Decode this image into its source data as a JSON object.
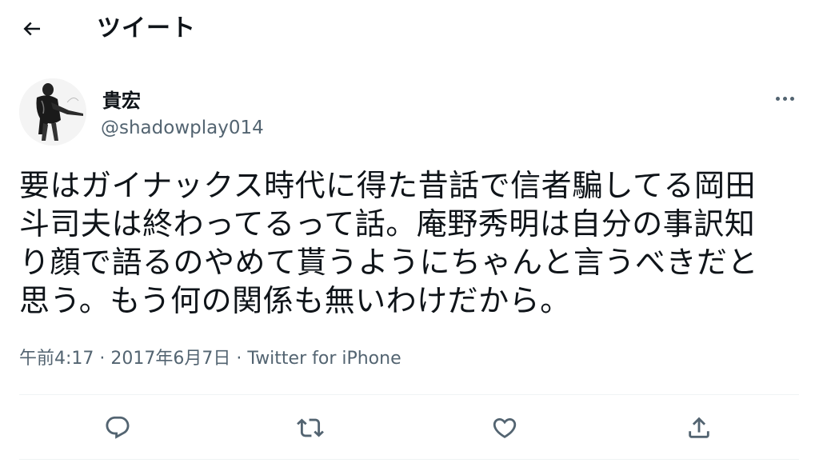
{
  "header": {
    "back_icon": "arrow-left-icon",
    "title": "ツイート"
  },
  "author": {
    "display_name": "貴宏",
    "handle": "@shadowplay014",
    "avatar_icon": "avatar-illustration"
  },
  "tweet": {
    "lines": [
      "要はガイナックス時代に得た昔話で信者騙してる岡田",
      "斗司夫は終わってるって話。庵野秀明は自分の事訳知",
      "り顔で語るのやめて貰うようにちゃんと言うべきだと",
      "思う。もう何の関係も無いわけだから。"
    ]
  },
  "meta": {
    "time": "午前4:17",
    "separator": "·",
    "date": "2017年6月7日",
    "source": "Twitter for iPhone"
  },
  "actions": {
    "reply_icon": "reply-icon",
    "retweet_icon": "retweet-icon",
    "like_icon": "heart-icon",
    "share_icon": "share-icon"
  },
  "colors": {
    "text": "#0f1419",
    "secondary": "#536471",
    "divider": "#eff3f4"
  }
}
